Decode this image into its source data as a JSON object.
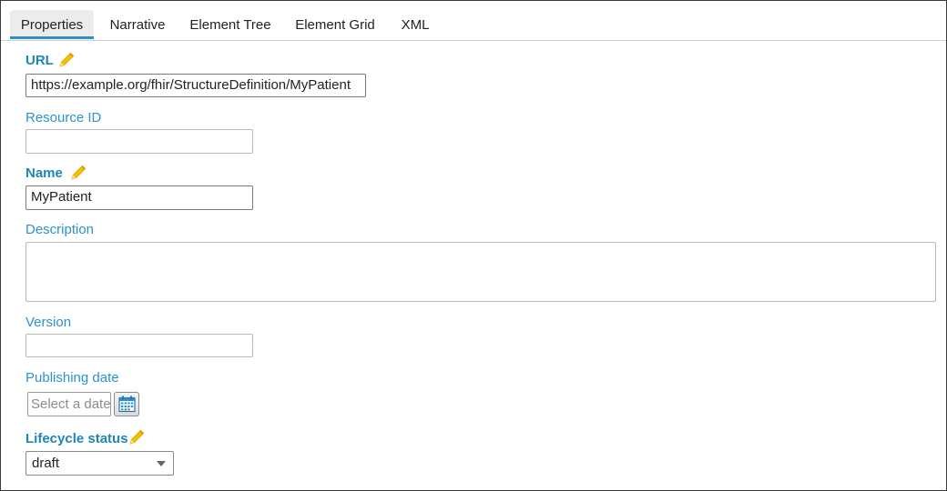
{
  "tabs": [
    {
      "label": "Properties",
      "active": true
    },
    {
      "label": "Narrative"
    },
    {
      "label": "Element Tree"
    },
    {
      "label": "Element Grid"
    },
    {
      "label": "XML"
    }
  ],
  "form": {
    "url": {
      "label": "URL",
      "value": "https://example.org/fhir/StructureDefinition/MyPatient"
    },
    "resource_id": {
      "label": "Resource ID",
      "value": ""
    },
    "name": {
      "label": "Name",
      "value": "MyPatient"
    },
    "description": {
      "label": "Description",
      "value": ""
    },
    "version": {
      "label": "Version",
      "value": ""
    },
    "publishing_date": {
      "label": "Publishing date",
      "placeholder": "Select a date"
    },
    "lifecycle_status": {
      "label": "Lifecycle status",
      "value": "draft"
    }
  },
  "icons": {
    "edit": "pencil-icon",
    "calendar": "calendar-icon",
    "dropdown": "chevron-down-icon"
  },
  "colors": {
    "accent": "#2b93c9",
    "pencil": "#f2c200"
  }
}
